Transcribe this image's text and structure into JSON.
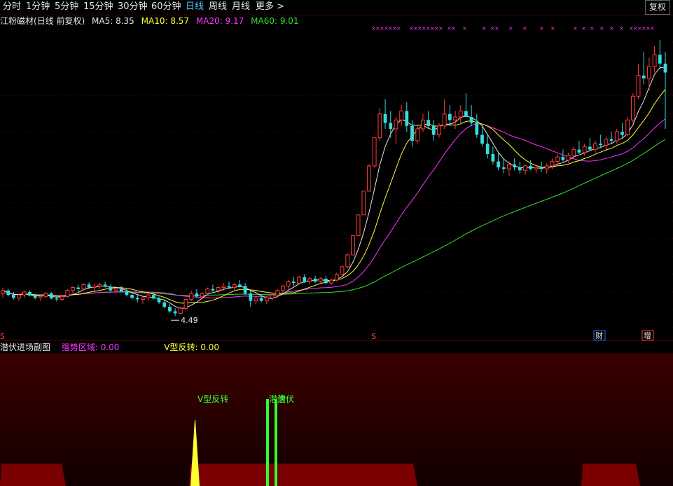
{
  "toolbar": {
    "tabs": [
      {
        "label": "分时",
        "active": false
      },
      {
        "label": "1分钟",
        "active": false
      },
      {
        "label": "5分钟",
        "active": false
      },
      {
        "label": "15分钟",
        "active": false
      },
      {
        "label": "30分钟",
        "active": false
      },
      {
        "label": "60分钟",
        "active": false
      },
      {
        "label": "日线",
        "active": true
      },
      {
        "label": "周线",
        "active": false
      },
      {
        "label": "月线",
        "active": false
      },
      {
        "label": "更多 >",
        "active": false
      }
    ],
    "fuquan_label": "复权"
  },
  "legend": {
    "stock_title": "江粉磁材(日线 前复权)",
    "ma5": {
      "label": "MA5: 8.35",
      "color": "#e6e6e6"
    },
    "ma10": {
      "label": "MA10: 8.57",
      "color": "#ffff33"
    },
    "ma20": {
      "label": "MA20: 9.17",
      "color": "#ff33ff"
    },
    "ma60": {
      "label": "MA60: 9.01",
      "color": "#33dd33"
    }
  },
  "annotations": {
    "low_price": "4.49",
    "marker_s1": "S",
    "marker_s2": "S",
    "badge_cai": "财",
    "badge_zeng": "增"
  },
  "sub_panel": {
    "title": "潜伏进场副图",
    "strong_zone": "强势区域: 0.00",
    "v_reversal": "V型反转: 0.00",
    "signal_v": "V型反转",
    "signal_qf1": "潜伏",
    "signal_qf2": "潜伏"
  },
  "colors": {
    "up": "#ff3c3c",
    "down": "#33dddd",
    "ma5": "#e6e6e6",
    "ma10": "#ffff33",
    "ma20": "#ff33ff",
    "ma60": "#33dd33"
  },
  "chart_data": {
    "type": "candlestick",
    "price_range": [
      4.0,
      14.2
    ],
    "candles": [
      [
        5.25,
        5.45,
        5.1,
        5.35
      ],
      [
        5.35,
        5.4,
        5.15,
        5.2
      ],
      [
        5.2,
        5.3,
        5.05,
        5.1
      ],
      [
        5.1,
        5.25,
        5.0,
        5.2
      ],
      [
        5.2,
        5.35,
        5.1,
        5.3
      ],
      [
        5.3,
        5.35,
        5.15,
        5.18
      ],
      [
        5.18,
        5.25,
        5.05,
        5.1
      ],
      [
        5.1,
        5.2,
        5.0,
        5.15
      ],
      [
        5.15,
        5.3,
        5.1,
        5.25
      ],
      [
        5.25,
        5.3,
        5.05,
        5.08
      ],
      [
        5.08,
        5.15,
        4.98,
        5.05
      ],
      [
        5.05,
        5.2,
        5.0,
        5.15
      ],
      [
        5.15,
        5.4,
        5.1,
        5.35
      ],
      [
        5.35,
        5.5,
        5.25,
        5.45
      ],
      [
        5.45,
        5.55,
        5.3,
        5.4
      ],
      [
        5.4,
        5.6,
        5.35,
        5.55
      ],
      [
        5.55,
        5.62,
        5.4,
        5.45
      ],
      [
        5.45,
        5.58,
        5.35,
        5.5
      ],
      [
        5.5,
        5.6,
        5.4,
        5.55
      ],
      [
        5.55,
        5.65,
        5.45,
        5.48
      ],
      [
        5.48,
        5.55,
        5.3,
        5.35
      ],
      [
        5.35,
        5.45,
        5.25,
        5.4
      ],
      [
        5.4,
        5.5,
        5.3,
        5.32
      ],
      [
        5.32,
        5.4,
        5.15,
        5.2
      ],
      [
        5.2,
        5.3,
        5.05,
        5.1
      ],
      [
        5.1,
        5.2,
        4.95,
        5.05
      ],
      [
        5.05,
        5.15,
        4.9,
        5.1
      ],
      [
        5.1,
        5.25,
        5.0,
        5.2
      ],
      [
        5.2,
        5.3,
        5.05,
        5.08
      ],
      [
        5.08,
        5.15,
        4.9,
        4.95
      ],
      [
        4.95,
        5.05,
        4.75,
        4.8
      ],
      [
        4.8,
        4.9,
        4.6,
        4.65
      ],
      [
        4.65,
        4.75,
        4.49,
        4.58
      ],
      [
        4.58,
        4.8,
        4.55,
        4.75
      ],
      [
        4.75,
        5.1,
        4.7,
        5.05
      ],
      [
        5.05,
        5.35,
        5.0,
        5.25
      ],
      [
        5.25,
        5.4,
        5.1,
        5.15
      ],
      [
        5.15,
        5.3,
        5.05,
        5.25
      ],
      [
        5.25,
        5.45,
        5.2,
        5.4
      ],
      [
        5.4,
        5.55,
        5.3,
        5.35
      ],
      [
        5.35,
        5.5,
        5.25,
        5.45
      ],
      [
        5.45,
        5.6,
        5.35,
        5.5
      ],
      [
        5.5,
        5.65,
        5.4,
        5.45
      ],
      [
        5.45,
        5.6,
        5.35,
        5.55
      ],
      [
        5.55,
        5.7,
        5.45,
        5.5
      ],
      [
        5.5,
        5.6,
        5.2,
        5.25
      ],
      [
        5.25,
        5.35,
        4.8,
        5.0
      ],
      [
        5.0,
        5.15,
        4.9,
        5.1
      ],
      [
        5.1,
        5.2,
        4.95,
        5.0
      ],
      [
        5.0,
        5.15,
        4.9,
        5.1
      ],
      [
        5.1,
        5.25,
        5.0,
        5.2
      ],
      [
        5.2,
        5.4,
        5.1,
        5.35
      ],
      [
        5.35,
        5.55,
        5.25,
        5.5
      ],
      [
        5.5,
        5.7,
        5.4,
        5.65
      ],
      [
        5.65,
        5.8,
        5.5,
        5.6
      ],
      [
        5.6,
        5.85,
        5.55,
        5.8
      ],
      [
        5.8,
        5.9,
        5.6,
        5.65
      ],
      [
        5.65,
        5.8,
        5.55,
        5.75
      ],
      [
        5.75,
        5.85,
        5.6,
        5.65
      ],
      [
        5.65,
        5.8,
        5.6,
        5.75
      ],
      [
        5.75,
        5.85,
        5.55,
        5.6
      ],
      [
        5.6,
        5.75,
        5.55,
        5.7
      ],
      [
        5.7,
        5.95,
        5.65,
        5.9
      ],
      [
        5.9,
        6.2,
        5.85,
        6.15
      ],
      [
        6.15,
        6.6,
        6.1,
        6.55
      ],
      [
        6.55,
        7.2,
        6.55,
        7.2
      ],
      [
        7.2,
        7.9,
        7.2,
        7.9
      ],
      [
        7.9,
        8.7,
        7.9,
        8.7
      ],
      [
        8.7,
        9.6,
        8.7,
        9.55
      ],
      [
        9.55,
        10.5,
        9.5,
        10.5
      ],
      [
        10.5,
        11.5,
        10.4,
        11.3
      ],
      [
        11.3,
        11.8,
        10.8,
        11.0
      ],
      [
        11.0,
        11.4,
        10.5,
        10.8
      ],
      [
        10.8,
        11.2,
        10.3,
        11.1
      ],
      [
        11.1,
        11.6,
        10.9,
        11.4
      ],
      [
        11.4,
        11.7,
        10.7,
        10.9
      ],
      [
        10.9,
        11.1,
        10.2,
        10.4
      ],
      [
        10.4,
        10.9,
        10.3,
        10.8
      ],
      [
        10.8,
        11.3,
        10.7,
        11.1
      ],
      [
        11.1,
        11.4,
        10.8,
        10.9
      ],
      [
        10.9,
        11.1,
        10.4,
        10.6
      ],
      [
        10.6,
        11.0,
        10.5,
        10.9
      ],
      [
        10.9,
        11.8,
        10.8,
        11.3
      ],
      [
        11.3,
        11.6,
        10.9,
        11.1
      ],
      [
        11.1,
        11.4,
        10.8,
        11.2
      ],
      [
        11.2,
        11.6,
        11.0,
        11.4
      ],
      [
        11.4,
        12.0,
        11.2,
        11.2
      ],
      [
        11.2,
        11.6,
        10.9,
        11.0
      ],
      [
        11.0,
        11.3,
        10.5,
        10.6
      ],
      [
        10.6,
        10.9,
        10.2,
        10.3
      ],
      [
        10.3,
        10.6,
        9.8,
        9.95
      ],
      [
        9.95,
        10.2,
        9.6,
        9.7
      ],
      [
        9.7,
        10.0,
        9.4,
        9.5
      ],
      [
        9.5,
        9.8,
        9.3,
        9.45
      ],
      [
        9.45,
        9.7,
        9.2,
        9.6
      ],
      [
        9.6,
        9.8,
        9.4,
        9.5
      ],
      [
        9.5,
        9.7,
        9.3,
        9.4
      ],
      [
        9.4,
        9.6,
        9.25,
        9.55
      ],
      [
        9.55,
        9.75,
        9.4,
        9.45
      ],
      [
        9.45,
        9.6,
        9.3,
        9.5
      ],
      [
        9.5,
        9.7,
        9.35,
        9.45
      ],
      [
        9.45,
        9.65,
        9.3,
        9.55
      ],
      [
        9.55,
        9.8,
        9.45,
        9.7
      ],
      [
        9.7,
        9.95,
        9.6,
        9.85
      ],
      [
        9.85,
        10.1,
        9.7,
        9.75
      ],
      [
        9.75,
        10.0,
        9.65,
        9.9
      ],
      [
        9.9,
        10.2,
        9.8,
        10.1
      ],
      [
        10.1,
        10.4,
        9.95,
        10.0
      ],
      [
        10.0,
        10.3,
        9.9,
        10.2
      ],
      [
        10.2,
        10.5,
        10.05,
        10.1
      ],
      [
        10.1,
        10.4,
        10.0,
        10.3
      ],
      [
        10.3,
        10.6,
        10.15,
        10.25
      ],
      [
        10.25,
        10.55,
        10.1,
        10.45
      ],
      [
        10.45,
        10.7,
        10.3,
        10.4
      ],
      [
        10.4,
        10.8,
        10.3,
        10.7
      ],
      [
        10.7,
        11.0,
        10.5,
        10.6
      ],
      [
        10.6,
        11.2,
        10.55,
        11.1
      ],
      [
        11.1,
        12.0,
        11.0,
        11.9
      ],
      [
        11.9,
        13.0,
        11.8,
        12.6
      ],
      [
        12.6,
        13.4,
        12.3,
        12.5
      ],
      [
        12.5,
        13.2,
        12.1,
        12.9
      ],
      [
        12.9,
        13.6,
        12.7,
        13.3
      ],
      [
        13.3,
        13.8,
        12.8,
        13.0
      ],
      [
        13.0,
        13.4,
        10.8,
        12.7
      ]
    ],
    "markers": [
      "S",
      "S",
      "财",
      "增"
    ],
    "low_label": 4.49,
    "sub_indicator": {
      "strong_zone": 0.0,
      "v_reversal": 0.0
    }
  }
}
